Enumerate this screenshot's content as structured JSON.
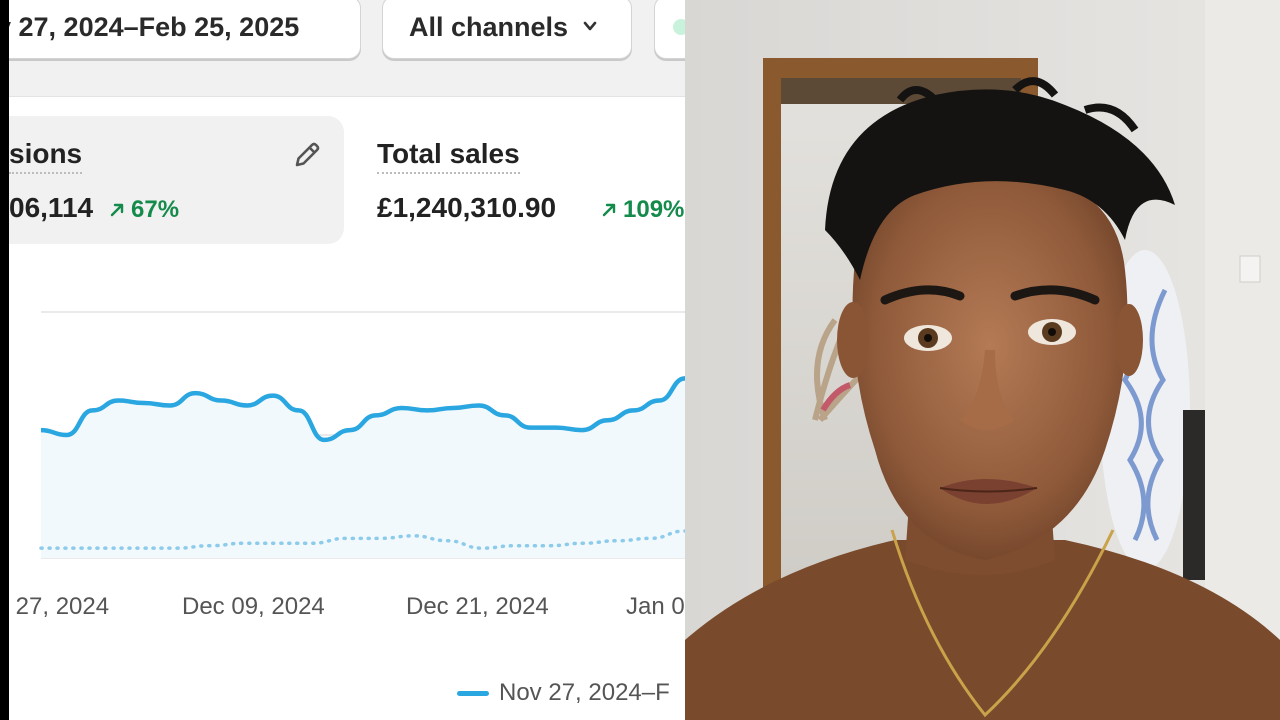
{
  "filters": {
    "date_range": "v 27, 2024–Feb 25, 2025",
    "channel_select": "All channels"
  },
  "metrics": [
    {
      "title": "sions",
      "value": "06,114",
      "change": "67%"
    },
    {
      "title": "Total sales",
      "value": "£1,240,310.90",
      "change": "109%"
    }
  ],
  "chart_data": {
    "type": "line",
    "x_tick_labels": [
      "r 27, 2024",
      "Dec 09, 2024",
      "Dec 21, 2024",
      "Jan 0"
    ],
    "series": [
      {
        "name": "Nov 27, 2024–F",
        "style": "solid",
        "color": "#2aa6e0",
        "values": [
          52,
          50,
          60,
          64,
          63,
          62,
          67,
          64,
          62,
          66,
          60,
          48,
          52,
          58,
          61,
          60,
          61,
          62,
          58,
          53,
          53,
          52,
          56,
          60,
          64,
          73
        ]
      },
      {
        "name": "",
        "style": "dotted",
        "color": "#8ccbea",
        "values": [
          4,
          4,
          4,
          4,
          4,
          5,
          6,
          6,
          6,
          8,
          8,
          9,
          7,
          4,
          5,
          5,
          6,
          7,
          8,
          11
        ]
      }
    ],
    "grid": true
  },
  "colors": {
    "accent": "#2aa6e0",
    "positive": "#148a4b"
  },
  "icons": {
    "pencil": "pencil-icon",
    "chevron": "chevron-down-icon",
    "trend_up": "arrow-up-right-icon"
  }
}
